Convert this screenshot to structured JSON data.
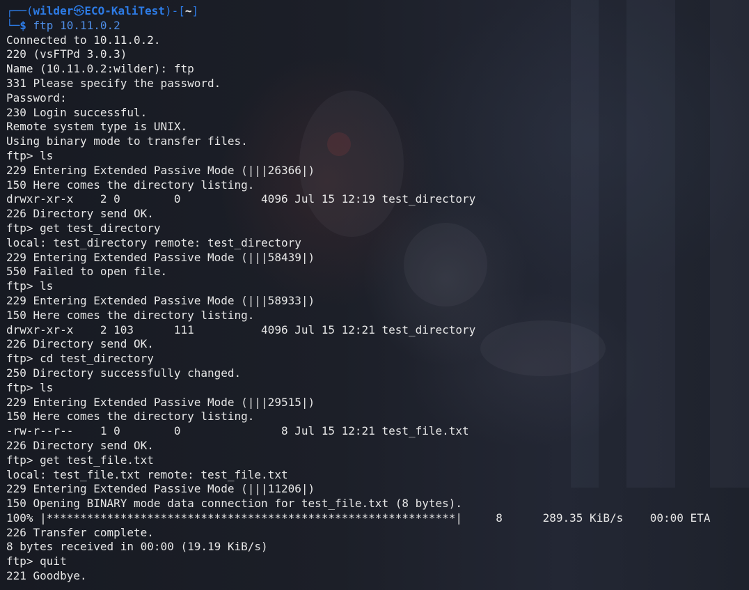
{
  "prompt": {
    "user": "wilder",
    "skull": "㉿",
    "host": "ECO-KaliTest",
    "cwd": "~",
    "command": "ftp 10.11.0.2"
  },
  "output_lines": [
    "Connected to 10.11.0.2.",
    "220 (vsFTPd 3.0.3)",
    "Name (10.11.0.2:wilder): ftp",
    "331 Please specify the password.",
    "Password:",
    "230 Login successful.",
    "Remote system type is UNIX.",
    "Using binary mode to transfer files.",
    "ftp> ls",
    "229 Entering Extended Passive Mode (|||26366|)",
    "150 Here comes the directory listing.",
    "drwxr-xr-x    2 0        0            4096 Jul 15 12:19 test_directory",
    "226 Directory send OK.",
    "ftp> get test_directory",
    "local: test_directory remote: test_directory",
    "229 Entering Extended Passive Mode (|||58439|)",
    "550 Failed to open file.",
    "ftp> ls",
    "229 Entering Extended Passive Mode (|||58933|)",
    "150 Here comes the directory listing.",
    "drwxr-xr-x    2 103      111          4096 Jul 15 12:21 test_directory",
    "226 Directory send OK.",
    "ftp> cd test_directory",
    "250 Directory successfully changed.",
    "ftp> ls",
    "229 Entering Extended Passive Mode (|||29515|)",
    "150 Here comes the directory listing.",
    "-rw-r--r--    1 0        0               8 Jul 15 12:21 test_file.txt",
    "226 Directory send OK.",
    "ftp> get test_file.txt",
    "local: test_file.txt remote: test_file.txt",
    "229 Entering Extended Passive Mode (|||11206|)",
    "150 Opening BINARY mode data connection for test_file.txt (8 bytes).",
    "100% |*************************************************************|     8      289.35 KiB/s    00:00 ETA",
    "226 Transfer complete.",
    "8 bytes received in 00:00 (19.19 KiB/s)",
    "ftp> quit",
    "221 Goodbye."
  ],
  "colors": {
    "prompt_blue": "#2d7be5",
    "text": "#e6e6e6",
    "background": "#171a22"
  }
}
